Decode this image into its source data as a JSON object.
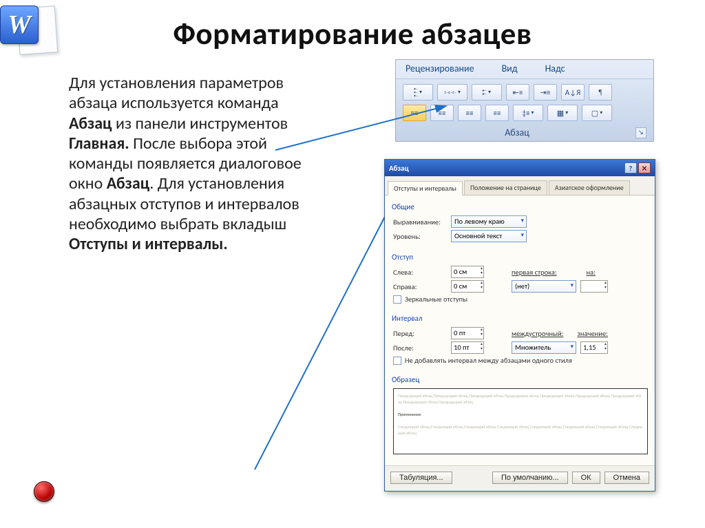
{
  "slide": {
    "title": "Форматирование абзацев",
    "body_html": "Для установления параметров абзаца используется команда <b>Абзац</b> из панели инструментов <b>Главная.</b> После выбора этой команды появляется диалоговое окно <b>Абзац</b>. Для установления абзацных отступов и интервалов необходимо выбрать вкладыш <b>Отступы и интервалы.</b>"
  },
  "ribbon": {
    "tabs": [
      "Рецензирование",
      "Вид",
      "Надс"
    ],
    "group_label": "Абзац",
    "buttons_row1": [
      {
        "name": "bullets-icon",
        "klass": "ico-bullets dd"
      },
      {
        "name": "numbering-icon",
        "klass": "ico-numbers dd"
      },
      {
        "name": "multilevel-icon",
        "klass": "ico-ml dd"
      },
      {
        "name": "outdent-icon",
        "klass": "ico-out"
      },
      {
        "name": "indent-icon",
        "klass": "ico-in"
      },
      {
        "name": "sort-icon",
        "klass": "ico-sort",
        "text": "А↓Я"
      },
      {
        "name": "pilcrow-icon",
        "klass": "ico-pilcrow",
        "text": "¶"
      }
    ],
    "buttons_row2": [
      {
        "name": "align-left-icon",
        "klass": "ico-al active",
        "text": "≡"
      },
      {
        "name": "align-center-icon",
        "klass": "ico-al",
        "text": "≡"
      },
      {
        "name": "align-right-icon",
        "klass": "ico-al",
        "text": "≡"
      },
      {
        "name": "justify-icon",
        "klass": "ico-al",
        "text": "≡"
      },
      {
        "name": "line-spacing-icon",
        "klass": "dd",
        "text": "‡≡"
      },
      {
        "name": "shading-icon",
        "klass": "ico-shade dd"
      },
      {
        "name": "borders-icon",
        "klass": "ico-border dd"
      }
    ]
  },
  "dialog": {
    "title": "Абзац",
    "tabs": [
      "Отступы и интервалы",
      "Положение на странице",
      "Азиатское оформление"
    ],
    "active_tab": 0,
    "sections": {
      "general": {
        "label": "Общие",
        "align_label": "Выравнивание:",
        "align_value": "По левому краю",
        "level_label": "Уровень:",
        "level_value": "Основной текст"
      },
      "indent": {
        "label": "Отступ",
        "left_label": "Слева:",
        "left_value": "0 см",
        "right_label": "Справа:",
        "right_value": "0 см",
        "first_label": "первая строка:",
        "first_value": "(нет)",
        "by_label": "на:",
        "by_value": "",
        "mirror_chk": "Зеркальные отступы"
      },
      "spacing": {
        "label": "Интервал",
        "before_label": "Перед:",
        "before_value": "0 пт",
        "after_label": "После:",
        "after_value": "10 пт",
        "line_label": "междустрочный:",
        "line_value": "Множитель",
        "at_label": "значение:",
        "at_value": "1,15",
        "noadd_chk": "Не добавлять интервал между абзацами одного стиля"
      },
      "preview_label": "Образец"
    },
    "buttons": {
      "tabs": "Табуляция...",
      "default": "По умолчанию...",
      "ok": "ОК",
      "cancel": "Отмена"
    }
  }
}
